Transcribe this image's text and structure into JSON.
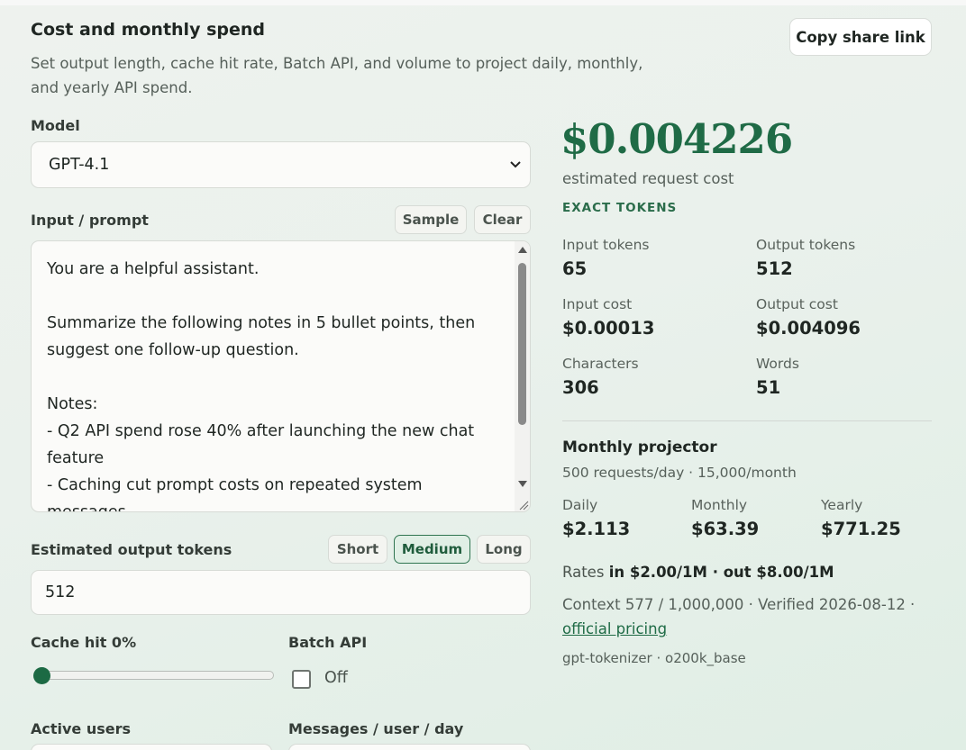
{
  "header": {
    "title": "Cost and monthly spend",
    "subtitle": "Set output length, cache hit rate, Batch API, and volume to project daily, monthly, and yearly API spend.",
    "share_label": "Copy share link"
  },
  "model": {
    "label": "Model",
    "selected": "GPT-4.1"
  },
  "prompt": {
    "label": "Input / prompt",
    "sample_label": "Sample",
    "clear_label": "Clear",
    "text": "You are a helpful assistant.\n\nSummarize the following notes in 5 bullet points, then suggest one follow-up question.\n\nNotes:\n- Q2 API spend rose 40% after launching the new chat feature\n- Caching cut prompt costs on repeated system messages"
  },
  "output_tokens": {
    "label": "Estimated output tokens",
    "presets": [
      "Short",
      "Medium",
      "Long"
    ],
    "active_preset": "Medium",
    "value": "512"
  },
  "cache": {
    "label": "Cache hit 0%",
    "value_percent": 0
  },
  "batch": {
    "label": "Batch API",
    "state_label": "Off",
    "checked": false
  },
  "volume": {
    "users_label": "Active users",
    "messages_label": "Messages / user / day"
  },
  "summary": {
    "cost": "$0.004226",
    "cost_caption": "estimated request cost",
    "badge": "EXACT TOKENS",
    "stats": [
      {
        "label": "Input tokens",
        "value": "65"
      },
      {
        "label": "Output tokens",
        "value": "512"
      },
      {
        "label": "Input cost",
        "value": "$0.00013"
      },
      {
        "label": "Output cost",
        "value": "$0.004096"
      },
      {
        "label": "Characters",
        "value": "306"
      },
      {
        "label": "Words",
        "value": "51"
      }
    ]
  },
  "projector": {
    "title": "Monthly projector",
    "subtitle": "500 requests/day · 15,000/month",
    "items": [
      {
        "label": "Daily",
        "value": "$2.113"
      },
      {
        "label": "Monthly",
        "value": "$63.39"
      },
      {
        "label": "Yearly",
        "value": "$771.25"
      }
    ],
    "rates_prefix": "Rates",
    "rates_value": "in $2.00/1M · out $8.00/1M",
    "context": "Context 577 / 1,000,000 · Verified 2026-08-12 ·",
    "pricing_link": "official pricing",
    "tokenizer": "gpt-tokenizer · o200k_base"
  },
  "colors": {
    "accent": "#1f6b46",
    "active_bg": "#e0efe5"
  }
}
